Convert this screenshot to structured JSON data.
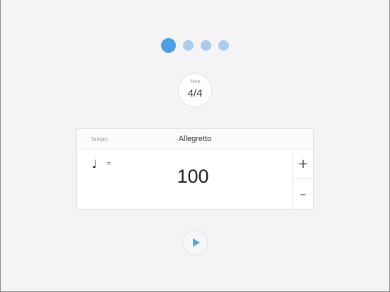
{
  "beats": {
    "count": 4,
    "active_index": 0,
    "active_color": "#4c9fe6",
    "inactive_color": "#a9cdee"
  },
  "time_signature": {
    "label": "Time",
    "value": "4/4"
  },
  "tempo": {
    "label": "Tempo",
    "name": "Allegretto",
    "note_symbol": "♩",
    "equals": "=",
    "bpm": "100",
    "increment_label": "+",
    "decrement_label": "–"
  },
  "controls": {
    "play_icon": "play-icon",
    "play_color": "#5aa3e6"
  }
}
